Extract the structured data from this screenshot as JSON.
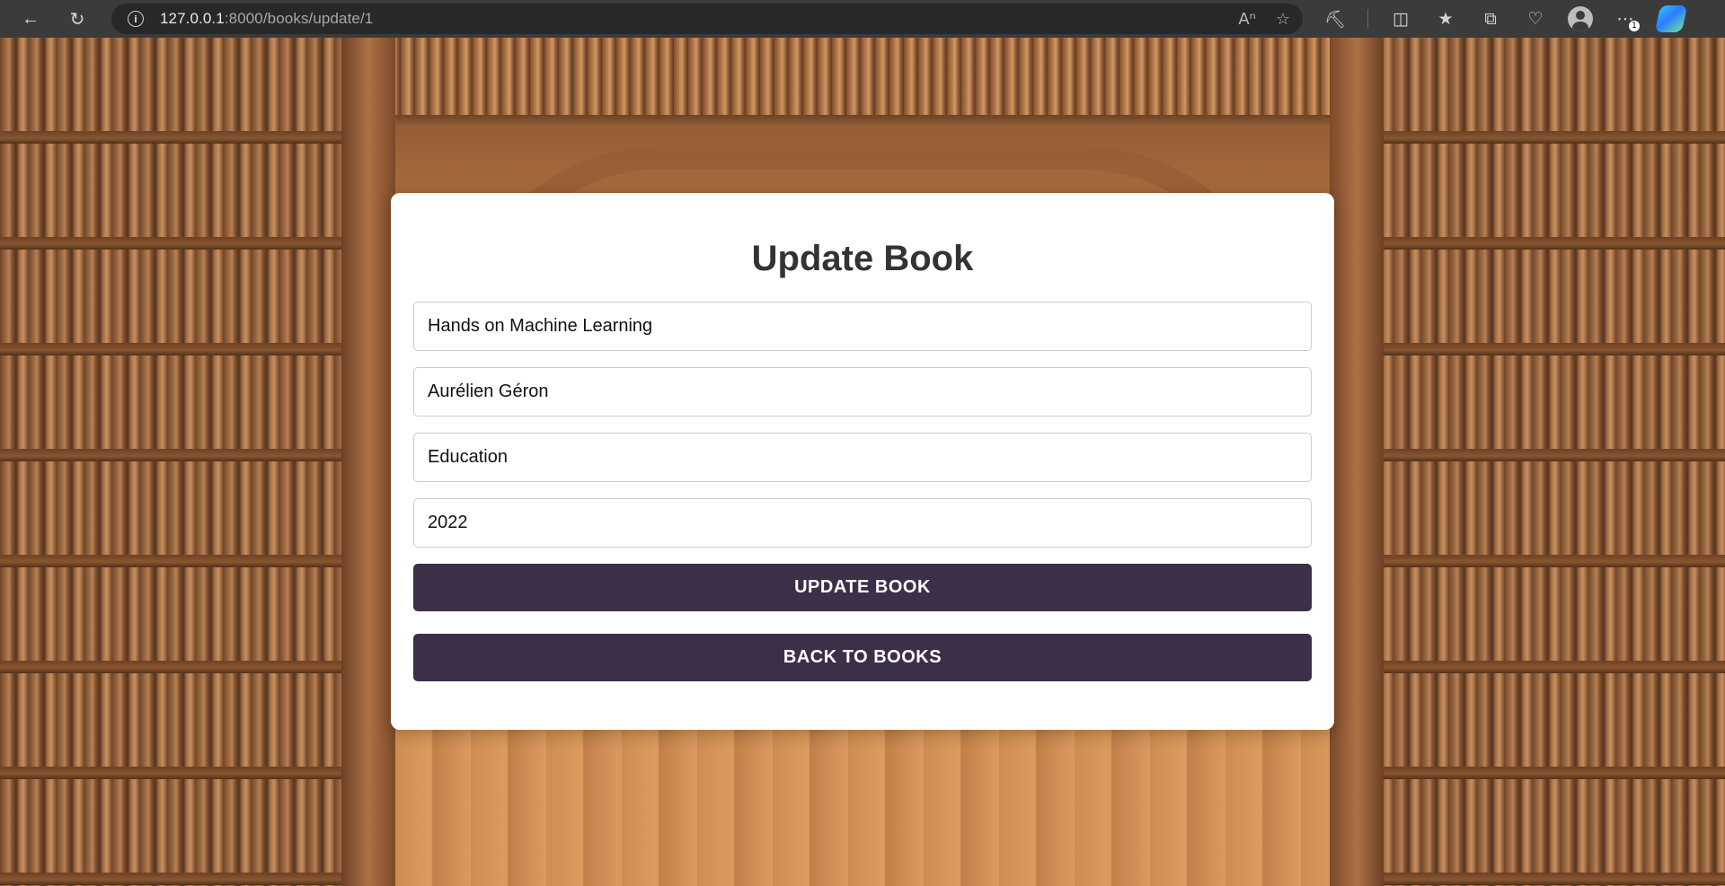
{
  "browser": {
    "url_host": "127.0.0.1",
    "url_rest": ":8000/books/update/1",
    "badge_count": "1"
  },
  "form": {
    "title": "Update Book",
    "fields": [
      {
        "name": "title",
        "value": "Hands on Machine Learning"
      },
      {
        "name": "author",
        "value": "Aurélien Géron"
      },
      {
        "name": "genre",
        "value": "Education"
      },
      {
        "name": "year",
        "value": "2022"
      }
    ],
    "submit_label": "UPDATE BOOK",
    "back_label": "BACK TO BOOKS"
  },
  "colors": {
    "button_bg": "#3c3049",
    "card_bg": "#ffffff",
    "title_color": "#333333",
    "browser_bar": "#3b3b3b"
  },
  "icons": {
    "back": "arrow-left-icon",
    "reload": "reload-icon",
    "site_info": "info-icon",
    "read_aloud": "read-aloud-icon",
    "favorite": "star-icon",
    "extensions": "puzzle-icon",
    "split_screen": "split-screen-icon",
    "favorites": "favorites-icon",
    "collections": "collections-icon",
    "health": "browser-essentials-icon",
    "profile": "avatar-icon",
    "more": "more-icon",
    "copilot": "copilot-icon"
  }
}
